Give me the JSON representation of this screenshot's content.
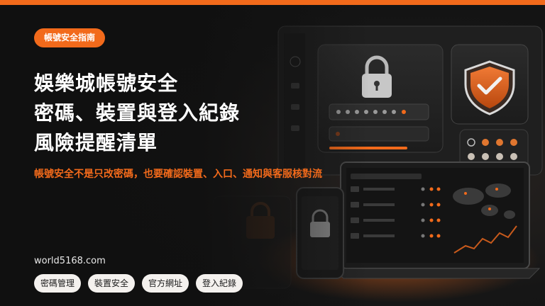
{
  "badge": "帳號安全指南",
  "headline": {
    "line1": "娛樂城帳號安全",
    "line2": "密碼、裝置與登入紀錄",
    "line3": "風險提醒清單"
  },
  "subtitle": "帳號安全不是只改密碼，也要確認裝置、入口、通知與客服核對流",
  "site": "world5168.com",
  "tags": [
    "密碼管理",
    "裝置安全",
    "官方網址",
    "登入紀錄"
  ],
  "colors": {
    "accent": "#f26a1b",
    "background": "#141414",
    "tag_bg": "#f4f1ee"
  },
  "illustration": {
    "icons": [
      "padlock-icon",
      "shield-check-icon",
      "world-map",
      "laptop",
      "smartphone"
    ]
  }
}
